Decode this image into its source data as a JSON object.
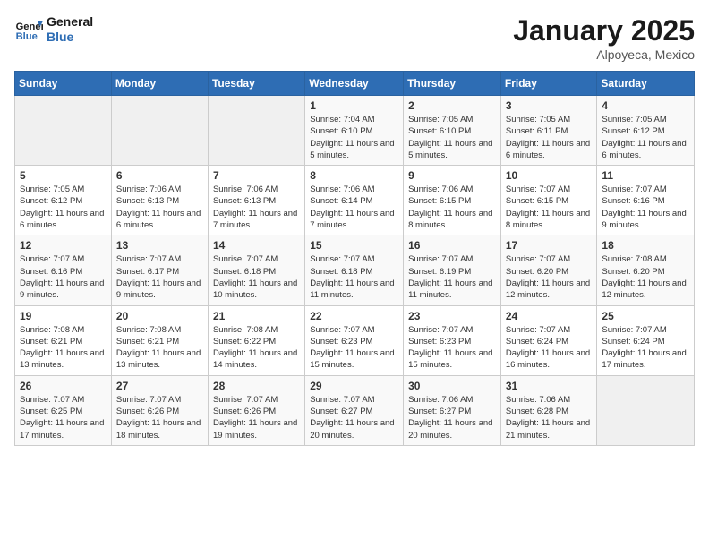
{
  "logo": {
    "line1": "General",
    "line2": "Blue"
  },
  "title": "January 2025",
  "subtitle": "Alpoyeca, Mexico",
  "weekdays": [
    "Sunday",
    "Monday",
    "Tuesday",
    "Wednesday",
    "Thursday",
    "Friday",
    "Saturday"
  ],
  "weeks": [
    [
      {
        "day": "",
        "info": ""
      },
      {
        "day": "",
        "info": ""
      },
      {
        "day": "",
        "info": ""
      },
      {
        "day": "1",
        "info": "Sunrise: 7:04 AM\nSunset: 6:10 PM\nDaylight: 11 hours and 5 minutes."
      },
      {
        "day": "2",
        "info": "Sunrise: 7:05 AM\nSunset: 6:10 PM\nDaylight: 11 hours and 5 minutes."
      },
      {
        "day": "3",
        "info": "Sunrise: 7:05 AM\nSunset: 6:11 PM\nDaylight: 11 hours and 6 minutes."
      },
      {
        "day": "4",
        "info": "Sunrise: 7:05 AM\nSunset: 6:12 PM\nDaylight: 11 hours and 6 minutes."
      }
    ],
    [
      {
        "day": "5",
        "info": "Sunrise: 7:05 AM\nSunset: 6:12 PM\nDaylight: 11 hours and 6 minutes."
      },
      {
        "day": "6",
        "info": "Sunrise: 7:06 AM\nSunset: 6:13 PM\nDaylight: 11 hours and 6 minutes."
      },
      {
        "day": "7",
        "info": "Sunrise: 7:06 AM\nSunset: 6:13 PM\nDaylight: 11 hours and 7 minutes."
      },
      {
        "day": "8",
        "info": "Sunrise: 7:06 AM\nSunset: 6:14 PM\nDaylight: 11 hours and 7 minutes."
      },
      {
        "day": "9",
        "info": "Sunrise: 7:06 AM\nSunset: 6:15 PM\nDaylight: 11 hours and 8 minutes."
      },
      {
        "day": "10",
        "info": "Sunrise: 7:07 AM\nSunset: 6:15 PM\nDaylight: 11 hours and 8 minutes."
      },
      {
        "day": "11",
        "info": "Sunrise: 7:07 AM\nSunset: 6:16 PM\nDaylight: 11 hours and 9 minutes."
      }
    ],
    [
      {
        "day": "12",
        "info": "Sunrise: 7:07 AM\nSunset: 6:16 PM\nDaylight: 11 hours and 9 minutes."
      },
      {
        "day": "13",
        "info": "Sunrise: 7:07 AM\nSunset: 6:17 PM\nDaylight: 11 hours and 9 minutes."
      },
      {
        "day": "14",
        "info": "Sunrise: 7:07 AM\nSunset: 6:18 PM\nDaylight: 11 hours and 10 minutes."
      },
      {
        "day": "15",
        "info": "Sunrise: 7:07 AM\nSunset: 6:18 PM\nDaylight: 11 hours and 11 minutes."
      },
      {
        "day": "16",
        "info": "Sunrise: 7:07 AM\nSunset: 6:19 PM\nDaylight: 11 hours and 11 minutes."
      },
      {
        "day": "17",
        "info": "Sunrise: 7:07 AM\nSunset: 6:20 PM\nDaylight: 11 hours and 12 minutes."
      },
      {
        "day": "18",
        "info": "Sunrise: 7:08 AM\nSunset: 6:20 PM\nDaylight: 11 hours and 12 minutes."
      }
    ],
    [
      {
        "day": "19",
        "info": "Sunrise: 7:08 AM\nSunset: 6:21 PM\nDaylight: 11 hours and 13 minutes."
      },
      {
        "day": "20",
        "info": "Sunrise: 7:08 AM\nSunset: 6:21 PM\nDaylight: 11 hours and 13 minutes."
      },
      {
        "day": "21",
        "info": "Sunrise: 7:08 AM\nSunset: 6:22 PM\nDaylight: 11 hours and 14 minutes."
      },
      {
        "day": "22",
        "info": "Sunrise: 7:07 AM\nSunset: 6:23 PM\nDaylight: 11 hours and 15 minutes."
      },
      {
        "day": "23",
        "info": "Sunrise: 7:07 AM\nSunset: 6:23 PM\nDaylight: 11 hours and 15 minutes."
      },
      {
        "day": "24",
        "info": "Sunrise: 7:07 AM\nSunset: 6:24 PM\nDaylight: 11 hours and 16 minutes."
      },
      {
        "day": "25",
        "info": "Sunrise: 7:07 AM\nSunset: 6:24 PM\nDaylight: 11 hours and 17 minutes."
      }
    ],
    [
      {
        "day": "26",
        "info": "Sunrise: 7:07 AM\nSunset: 6:25 PM\nDaylight: 11 hours and 17 minutes."
      },
      {
        "day": "27",
        "info": "Sunrise: 7:07 AM\nSunset: 6:26 PM\nDaylight: 11 hours and 18 minutes."
      },
      {
        "day": "28",
        "info": "Sunrise: 7:07 AM\nSunset: 6:26 PM\nDaylight: 11 hours and 19 minutes."
      },
      {
        "day": "29",
        "info": "Sunrise: 7:07 AM\nSunset: 6:27 PM\nDaylight: 11 hours and 20 minutes."
      },
      {
        "day": "30",
        "info": "Sunrise: 7:06 AM\nSunset: 6:27 PM\nDaylight: 11 hours and 20 minutes."
      },
      {
        "day": "31",
        "info": "Sunrise: 7:06 AM\nSunset: 6:28 PM\nDaylight: 11 hours and 21 minutes."
      },
      {
        "day": "",
        "info": ""
      }
    ]
  ]
}
